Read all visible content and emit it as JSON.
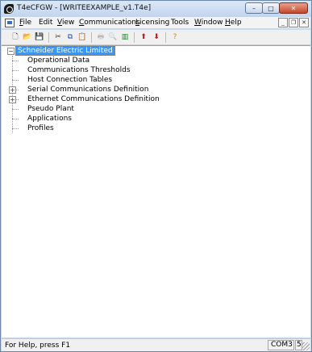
{
  "window": {
    "title": "T4eCFGW - [WRITEEXAMPLE_v1.T4e]",
    "caption_min": "–",
    "caption_max": "□",
    "caption_close": "✕"
  },
  "menu": {
    "items": [
      {
        "accel": "F",
        "rest": "ile"
      },
      {
        "accel": "",
        "rest": "Edit"
      },
      {
        "accel": "V",
        "rest": "iew"
      },
      {
        "accel": "C",
        "rest": "ommunications"
      },
      {
        "accel": "L",
        "rest": "icensing"
      },
      {
        "accel": "",
        "rest": "Tools"
      },
      {
        "accel": "W",
        "rest": "indow"
      },
      {
        "accel": "H",
        "rest": "elp"
      }
    ],
    "mdi_min": "_",
    "mdi_restore": "❐",
    "mdi_close": "✕"
  },
  "toolbar": {
    "icons": [
      {
        "name": "new-icon",
        "glyph": "🗋",
        "color": "#333333",
        "enabled": true
      },
      {
        "name": "open-icon",
        "glyph": "📂",
        "color": "#c48a00",
        "enabled": true
      },
      {
        "name": "save-icon",
        "glyph": "💾",
        "color": "#1f3f8f",
        "enabled": true
      },
      {
        "name": "cut-icon",
        "glyph": "✂",
        "color": "#333333",
        "enabled": true
      },
      {
        "name": "copy-icon",
        "glyph": "⧉",
        "color": "#1f4f9f",
        "enabled": true
      },
      {
        "name": "paste-icon",
        "glyph": "📋",
        "color": "#7a5a1a",
        "enabled": true
      },
      {
        "name": "print-icon",
        "glyph": "🖶",
        "color": "#555555",
        "enabled": false
      },
      {
        "name": "print-preview-icon",
        "glyph": "🔍",
        "color": "#555555",
        "enabled": false
      },
      {
        "name": "split-view-icon",
        "glyph": "▥",
        "color": "#1d7a2a",
        "enabled": true
      },
      {
        "name": "upload-icon",
        "glyph": "⬆",
        "color": "#c0181a",
        "enabled": true
      },
      {
        "name": "download-icon",
        "glyph": "⬇",
        "color": "#c0181a",
        "enabled": true
      },
      {
        "name": "help-icon",
        "glyph": "?",
        "color": "#c48a00",
        "enabled": true
      }
    ]
  },
  "tree": {
    "root": "Schneider Electric Limited",
    "children": [
      {
        "label": "Operational Data",
        "expandable": false
      },
      {
        "label": "Communications Thresholds",
        "expandable": false
      },
      {
        "label": "Host Connection Tables",
        "expandable": false
      },
      {
        "label": "Serial Communications Definition",
        "expandable": true
      },
      {
        "label": "Ethernet Communications Definition",
        "expandable": true
      },
      {
        "label": "Pseudo Plant",
        "expandable": false
      },
      {
        "label": "Applications",
        "expandable": false
      },
      {
        "label": "Profiles",
        "expandable": false
      }
    ],
    "collapse_glyph": "−",
    "expand_glyph": "+"
  },
  "status": {
    "text": "For Help, press F1",
    "port": "COM3",
    "extra": "5"
  },
  "colors": {
    "selection": "#3399ff"
  }
}
